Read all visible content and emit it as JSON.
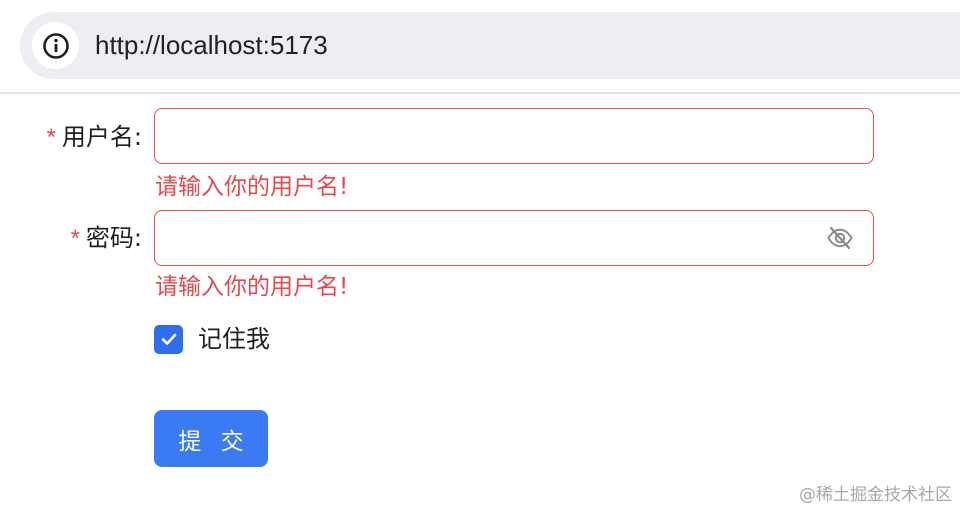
{
  "browser": {
    "url": "http://localhost:5173",
    "info_icon": "info-icon"
  },
  "form": {
    "username": {
      "required_mark": "*",
      "label": "用户名:",
      "value": "",
      "error": "请输入你的用户名!"
    },
    "password": {
      "required_mark": "*",
      "label": "密码:",
      "value": "",
      "toggle_icon": "eye-off-icon",
      "error": "请输入你的用户名!"
    },
    "remember": {
      "label": "记住我",
      "checked": true
    },
    "submit_label": "提 交"
  },
  "watermark": "@稀土掘金技术社区",
  "colors": {
    "error": "#e5484d",
    "primary": "#3a7af3",
    "checkbox": "#2f6eea",
    "address_bar": "#edeef2"
  }
}
